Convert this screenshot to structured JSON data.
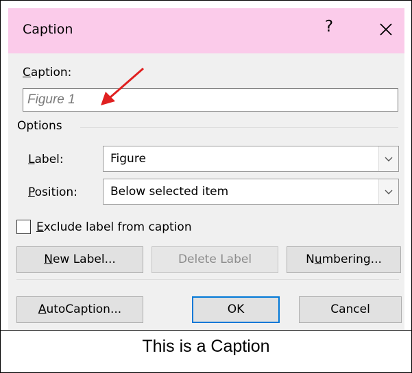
{
  "window": {
    "title": "Caption",
    "help": "?",
    "close": "close-icon"
  },
  "caption": {
    "label_underlined": "C",
    "label_rest": "aption:",
    "value": "Figure 1"
  },
  "options": {
    "header": "Options",
    "label": {
      "underlined": "L",
      "rest": "abel:",
      "value": "Figure"
    },
    "position": {
      "underlined": "P",
      "rest": "osition:",
      "value": "Below selected item"
    },
    "exclude": {
      "underlined": "E",
      "rest": "xclude label from caption",
      "checked": false
    }
  },
  "buttons": {
    "new_label": {
      "underlined": "N",
      "rest": "ew Label..."
    },
    "delete_label": "Delete Label",
    "numbering": {
      "before": "N",
      "underlined": "u",
      "rest": "mbering..."
    },
    "autocaption": {
      "underlined": "A",
      "rest": "utoCaption..."
    },
    "ok": "OK",
    "cancel": "Cancel"
  },
  "bottom_caption": "This is a Caption",
  "colors": {
    "titlebar": "#fbcbea",
    "dialog_bg": "#f0f0f0",
    "annotation_arrow": "#e02020",
    "ok_border": "#0078d7"
  }
}
